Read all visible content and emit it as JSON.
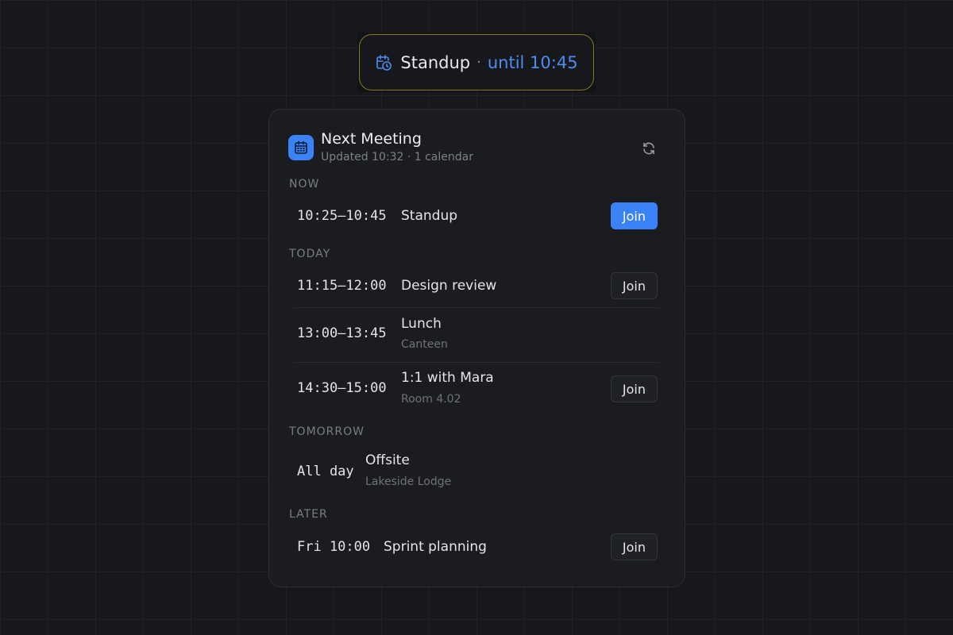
{
  "pill": {
    "title": "Standup",
    "separator": "·",
    "until": "until 10:45",
    "icon": "calendar-clock-icon",
    "accent": "#4c8df0",
    "border_color": "#8d7322"
  },
  "card": {
    "title": "Next Meeting",
    "subtitle": "Updated 10:32 · 1 calendar",
    "app_icon": "calendar-icon",
    "refresh_icon": "refresh-icon"
  },
  "sections": {
    "now": "NOW",
    "today": "TODAY",
    "tomorrow": "TOMORROW",
    "later": "LATER"
  },
  "meetings": [
    {
      "time": "10:25–10:45",
      "title": "Standup",
      "location": "",
      "join": "Join",
      "primary": true
    },
    {
      "time": "11:15–12:00",
      "title": "Design review",
      "location": "",
      "join": "Join"
    },
    {
      "time": "13:00–13:45",
      "title": "Lunch",
      "location": "Canteen"
    },
    {
      "time": "14:30–15:00",
      "title": "1:1 with Mara",
      "location": "Room 4.02",
      "join": "Join"
    },
    {
      "time": "All day",
      "title": "Offsite",
      "location": "Lakeside Lodge"
    },
    {
      "time": "Fri 10:00",
      "title": "Sprint planning",
      "location": "",
      "join": "Join"
    }
  ],
  "colors": {
    "background": "#17181c",
    "card": "#1b1c20",
    "primary_button": "#3b82f6"
  }
}
